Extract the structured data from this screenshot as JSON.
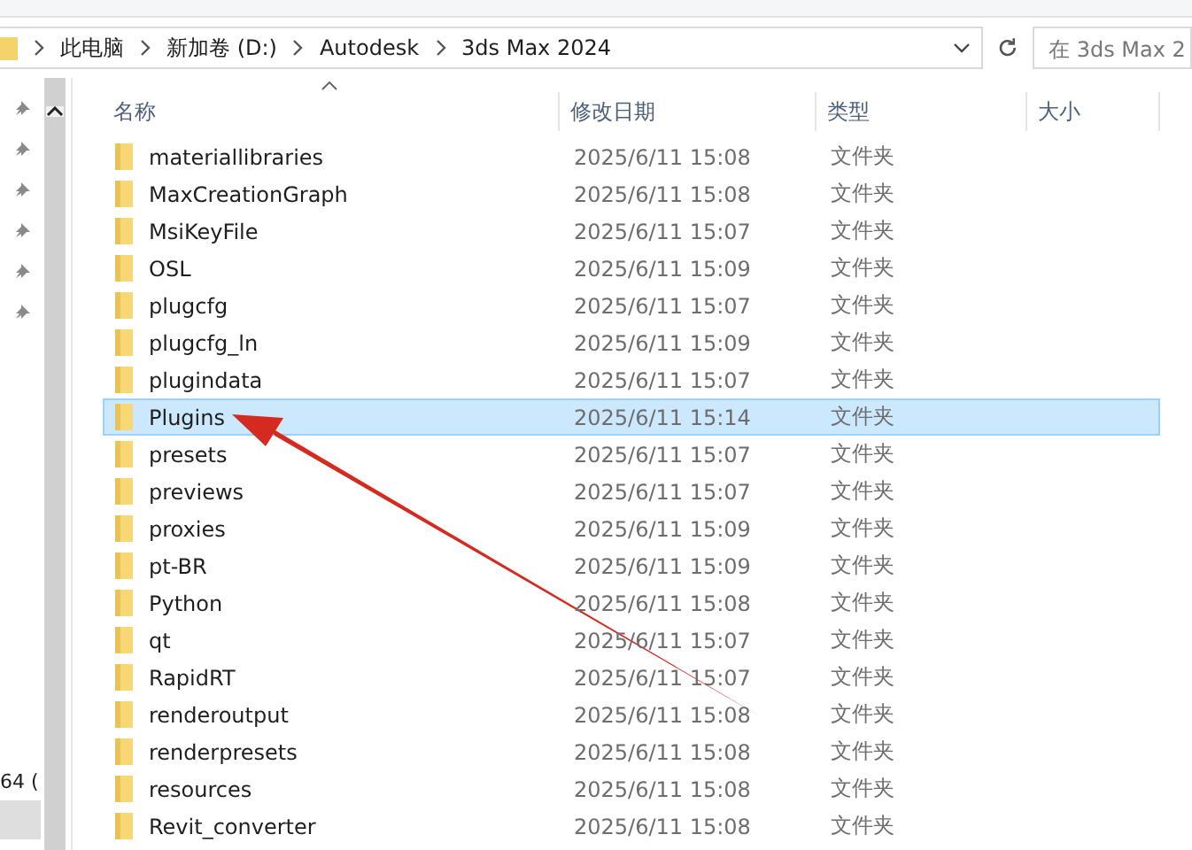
{
  "address_bar": {
    "path": [
      "此电脑",
      "新加卷 (D:)",
      "Autodesk",
      "3ds Max 2024"
    ],
    "search_placeholder": "在 3ds Max 2"
  },
  "nav_pane": {
    "partial_text": "64 ("
  },
  "columns": [
    "名称",
    "修改日期",
    "类型",
    "大小"
  ],
  "rows": [
    {
      "name": "materiallibraries",
      "modified": "2025/6/11 15:08",
      "type": "文件夹",
      "selected": false
    },
    {
      "name": "MaxCreationGraph",
      "modified": "2025/6/11 15:08",
      "type": "文件夹",
      "selected": false
    },
    {
      "name": "MsiKeyFile",
      "modified": "2025/6/11 15:07",
      "type": "文件夹",
      "selected": false
    },
    {
      "name": "OSL",
      "modified": "2025/6/11 15:09",
      "type": "文件夹",
      "selected": false
    },
    {
      "name": "plugcfg",
      "modified": "2025/6/11 15:07",
      "type": "文件夹",
      "selected": false
    },
    {
      "name": "plugcfg_ln",
      "modified": "2025/6/11 15:09",
      "type": "文件夹",
      "selected": false
    },
    {
      "name": "plugindata",
      "modified": "2025/6/11 15:07",
      "type": "文件夹",
      "selected": false
    },
    {
      "name": "Plugins",
      "modified": "2025/6/11 15:14",
      "type": "文件夹",
      "selected": true
    },
    {
      "name": "presets",
      "modified": "2025/6/11 15:07",
      "type": "文件夹",
      "selected": false
    },
    {
      "name": "previews",
      "modified": "2025/6/11 15:07",
      "type": "文件夹",
      "selected": false
    },
    {
      "name": "proxies",
      "modified": "2025/6/11 15:09",
      "type": "文件夹",
      "selected": false
    },
    {
      "name": "pt-BR",
      "modified": "2025/6/11 15:09",
      "type": "文件夹",
      "selected": false
    },
    {
      "name": "Python",
      "modified": "2025/6/11 15:08",
      "type": "文件夹",
      "selected": false
    },
    {
      "name": "qt",
      "modified": "2025/6/11 15:07",
      "type": "文件夹",
      "selected": false
    },
    {
      "name": "RapidRT",
      "modified": "2025/6/11 15:07",
      "type": "文件夹",
      "selected": false
    },
    {
      "name": "renderoutput",
      "modified": "2025/6/11 15:08",
      "type": "文件夹",
      "selected": false
    },
    {
      "name": "renderpresets",
      "modified": "2025/6/11 15:08",
      "type": "文件夹",
      "selected": false
    },
    {
      "name": "resources",
      "modified": "2025/6/11 15:08",
      "type": "文件夹",
      "selected": false
    },
    {
      "name": "Revit_converter",
      "modified": "2025/6/11 15:08",
      "type": "文件夹",
      "selected": false
    }
  ]
}
